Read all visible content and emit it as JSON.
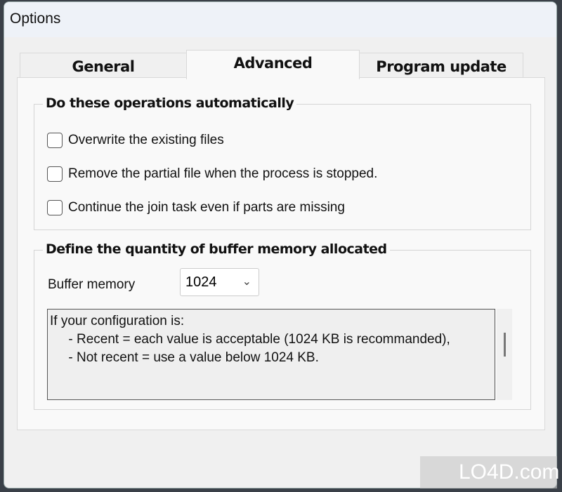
{
  "window": {
    "title": "Options"
  },
  "tabs": [
    {
      "label": "General"
    },
    {
      "label": "Advanced",
      "active": true
    },
    {
      "label": "Program update"
    }
  ],
  "auto_group": {
    "title": "Do these operations automatically",
    "options": [
      {
        "label": "Overwrite the existing files",
        "checked": false
      },
      {
        "label": "Remove the partial file when the process is stopped.",
        "checked": false
      },
      {
        "label": "Continue the join task even if parts are missing",
        "checked": false
      }
    ]
  },
  "buffer_group": {
    "title": "Define the quantity of buffer memory allocated",
    "label": "Buffer memory",
    "value": "1024",
    "info": "If your configuration is:\n     - Recent = each value is acceptable (1024 KB is recommanded),\n     - Not recent = use a value below 1024 KB."
  },
  "watermark": "LO4D.com"
}
